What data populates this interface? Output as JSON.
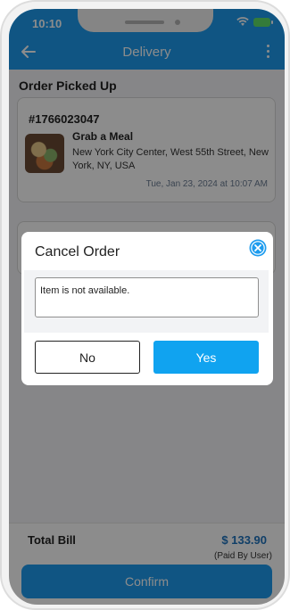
{
  "status_bar": {
    "time": "10:10"
  },
  "header": {
    "title": "Delivery",
    "back_icon": "arrow-left-icon",
    "more_icon": "more-vertical-icon"
  },
  "section": {
    "title": "Order Picked Up"
  },
  "order": {
    "number": "#1766023047",
    "restaurant": "Grab a Meal",
    "address": "New York City Center, West 55th Street, New York, NY, USA",
    "date": "Tue, Jan 23, 2024 at 10:07 AM"
  },
  "bill": {
    "label": "Total Bill",
    "amount": "$ 133.90",
    "paid_by": "(Paid By User)"
  },
  "confirm_label": "Confirm",
  "dialog": {
    "title": "Cancel Order",
    "reason_value": "Item is not available.",
    "no_label": "No",
    "yes_label": "Yes",
    "close_icon": "close-circle-icon"
  },
  "colors": {
    "primary": "#1e9cee",
    "amount": "#1e73be",
    "yes_button": "#10a3f0",
    "battery": "#5fe06b"
  }
}
